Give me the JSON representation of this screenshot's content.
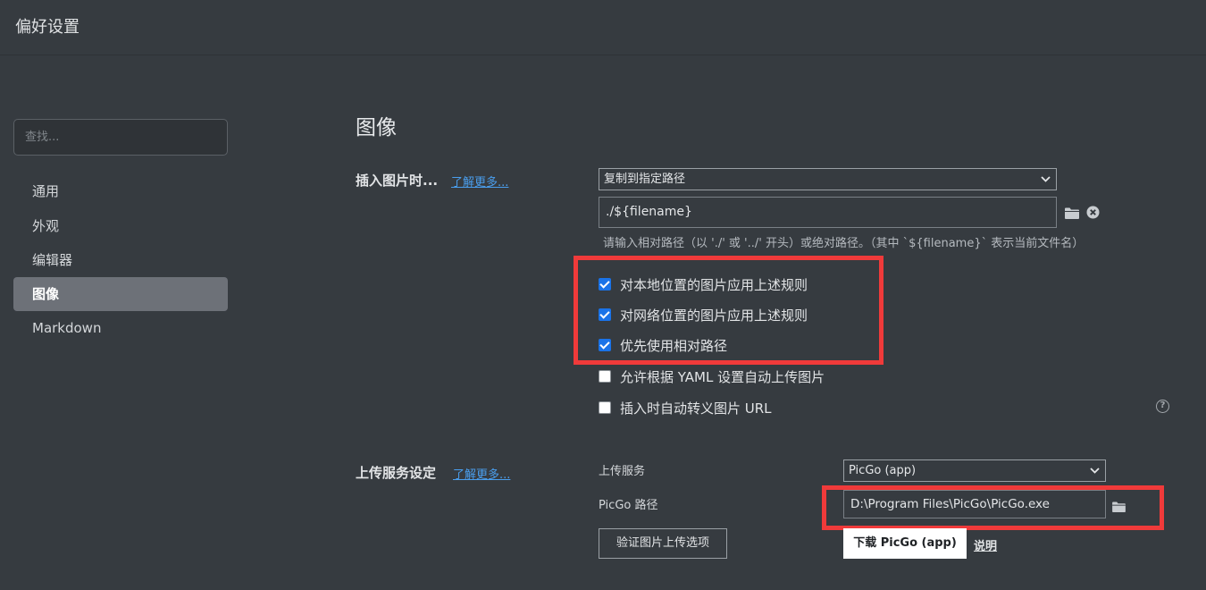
{
  "window": {
    "title": "偏好设置"
  },
  "search": {
    "placeholder": "查找..."
  },
  "sidebar": {
    "items": [
      {
        "label": "通用"
      },
      {
        "label": "外观"
      },
      {
        "label": "编辑器"
      },
      {
        "label": "图像"
      },
      {
        "label": "Markdown"
      }
    ],
    "active": "图像"
  },
  "main": {
    "section_title": "图像",
    "insert": {
      "label": "插入图片时...",
      "learn_more": "了解更多...",
      "mode_select": "复制到指定路径",
      "path_value": "./${filename}",
      "hint": "请输入相对路径（以 './' 或 '../' 开头）或绝对路径。（其中 `${filename}` 表示当前文件名）",
      "options": [
        {
          "label": "对本地位置的图片应用上述规则",
          "checked": true
        },
        {
          "label": "对网络位置的图片应用上述规则",
          "checked": true
        },
        {
          "label": "优先使用相对路径",
          "checked": true
        },
        {
          "label": "允许根据 YAML 设置自动上传图片",
          "checked": false
        },
        {
          "label": "插入时自动转义图片 URL",
          "checked": false
        }
      ]
    },
    "upload": {
      "label": "上传服务设定",
      "learn_more": "了解更多...",
      "service_label": "上传服务",
      "service_value": "PicGo (app)",
      "path_label": "PicGo 路径",
      "path_value": "D:\\Program Files\\PicGo\\PicGo.exe",
      "verify_button": "验证图片上传选项",
      "download_button": "下载 PicGo (app)",
      "explain_link": "说明"
    }
  },
  "colors": {
    "background": "#363b40",
    "accent": "#1a73e8",
    "link": "#4a9eed",
    "highlight_box": "#f03a3a"
  }
}
